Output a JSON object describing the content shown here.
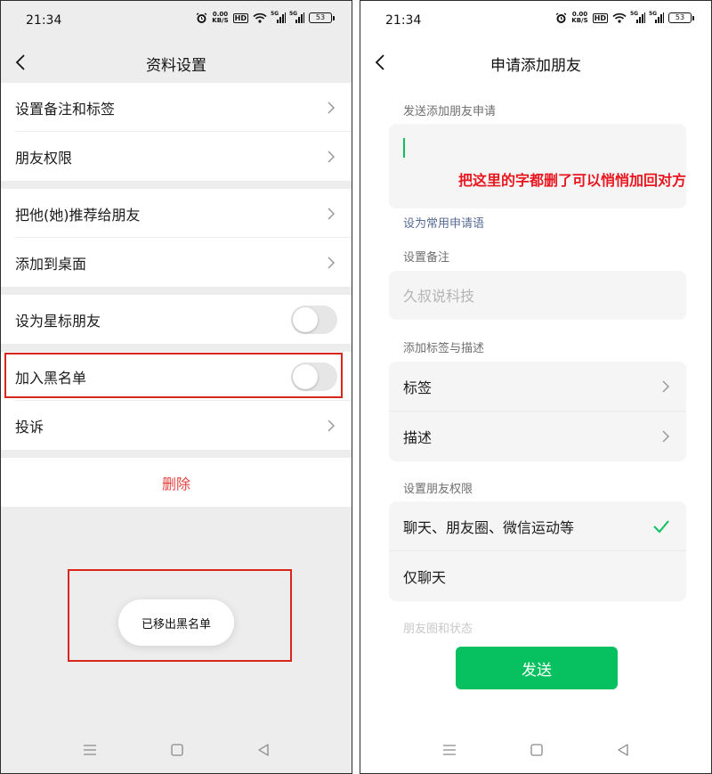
{
  "left": {
    "status": {
      "time": "21:34",
      "net_speed": "0.00",
      "net_unit": "KB/S",
      "hd": "HD",
      "g5a": "5G",
      "g5b": "5G",
      "battery": "53"
    },
    "nav": {
      "title": "资料设置"
    },
    "rows": {
      "remark": "设置备注和标签",
      "permissions": "朋友权限",
      "recommend": "把他(她)推荐给朋友",
      "desktop": "添加到桌面",
      "star": "设为星标朋友",
      "blacklist": "加入黑名单",
      "complaint": "投诉",
      "delete": "删除"
    },
    "toggles": {
      "star_on": false,
      "blacklist_on": false
    },
    "toast": "已移出黑名单"
  },
  "right": {
    "status": {
      "time": "21:34",
      "net_speed": "0.00",
      "net_unit": "KB/S",
      "hd": "HD",
      "g5a": "5G",
      "g5b": "5G",
      "battery": "53"
    },
    "nav": {
      "title": "申请添加朋友"
    },
    "request_label": "发送添加朋友申请",
    "annotation": "把这里的字都删了可以悄悄加回对方",
    "common_phrase_link": "设为常用申请语",
    "remark_label": "设置备注",
    "remark_placeholder": "久叔说科技",
    "tags_label": "添加标签与描述",
    "tags_row": "标签",
    "desc_row": "描述",
    "perm_label": "设置朋友权限",
    "perm_all": "聊天、朋友圈、微信运动等",
    "perm_chat": "仅聊天",
    "moments_label": "朋友圈和状态",
    "send_button": "发送"
  },
  "colors": {
    "accent_green": "#07c160",
    "danger_red": "#e64340",
    "annotation_red": "#e8171f",
    "link_blue": "#576b95"
  }
}
